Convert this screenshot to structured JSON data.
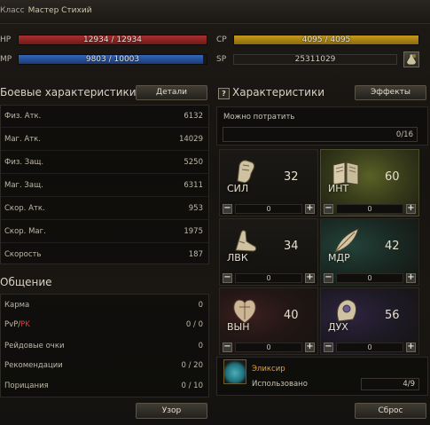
{
  "header": {
    "class_label": "Класс",
    "class_value": "Мастер Стихий"
  },
  "bars": {
    "hp": {
      "label": "HP",
      "text": "12934 / 12934",
      "fill": 1.0
    },
    "mp": {
      "label": "MP",
      "text": "9803 / 10003",
      "fill": 0.98
    },
    "cp": {
      "label": "CP",
      "text": "4095 / 4095",
      "fill": 1.0
    },
    "sp": {
      "label": "SP",
      "text": "25311029"
    }
  },
  "combat": {
    "title": "Боевые характеристики",
    "details_button": "Детали",
    "rows": [
      {
        "name": "Физ. Атк.",
        "value": "6132"
      },
      {
        "name": "Маг. Атк.",
        "value": "14029"
      },
      {
        "name": "Физ. Защ.",
        "value": "5250"
      },
      {
        "name": "Маг. Защ.",
        "value": "6311"
      },
      {
        "name": "Скор. Атк.",
        "value": "953"
      },
      {
        "name": "Скор. Маг.",
        "value": "1975"
      },
      {
        "name": "Скорость",
        "value": "187"
      }
    ]
  },
  "social": {
    "title": "Общение",
    "rows": [
      {
        "name": "Карма",
        "value": "0"
      },
      {
        "name_a": "PvP/",
        "name_b": "PK",
        "value": "0 / 0"
      },
      {
        "name": "Рейдовые очки",
        "value": "0"
      },
      {
        "name": "Рекомендации",
        "value": "0 / 20"
      },
      {
        "name": "Порицания",
        "value": "0 / 10"
      }
    ],
    "view_button": "Узор"
  },
  "stats": {
    "help_icon": "?",
    "title": "Характеристики",
    "effects_button": "Эффекты",
    "spend_label": "Можно потратить",
    "spend_value": "0/16",
    "cards": [
      {
        "abbr": "СИЛ",
        "value": "32",
        "alloc": "0",
        "icon": "fist-icon"
      },
      {
        "abbr": "ИНТ",
        "value": "60",
        "alloc": "0",
        "icon": "book-icon"
      },
      {
        "abbr": "ЛВК",
        "value": "34",
        "alloc": "0",
        "icon": "foot-icon"
      },
      {
        "abbr": "МДР",
        "value": "42",
        "alloc": "0",
        "icon": "feather-icon"
      },
      {
        "abbr": "ВЫН",
        "value": "40",
        "alloc": "0",
        "icon": "heart-icon"
      },
      {
        "abbr": "ДУХ",
        "value": "56",
        "alloc": "0",
        "icon": "head-icon"
      }
    ],
    "minus": "−",
    "plus": "+",
    "elixir": {
      "title": "Эликсир",
      "used_label": "Использовано",
      "used_value": "4/9"
    },
    "reset_button": "Сброс"
  },
  "colors": {
    "elixir_title": "#e0a040",
    "pk": "#d04040"
  }
}
